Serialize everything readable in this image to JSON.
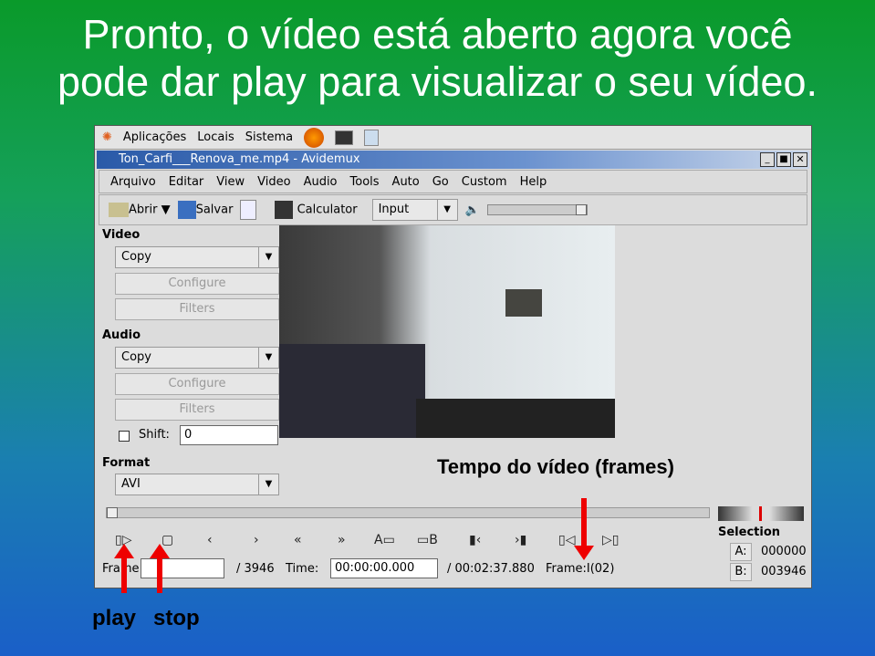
{
  "heading": {
    "line1": "Pronto, o vídeo está aberto agora você",
    "line2": "pode dar play para visualizar o seu vídeo."
  },
  "panel": {
    "items": [
      "Aplicações",
      "Locais",
      "Sistema"
    ]
  },
  "window": {
    "title": "Ton_Carfi___Renova_me.mp4 - Avidemux"
  },
  "menu": [
    "Arquivo",
    "Editar",
    "View",
    "Video",
    "Audio",
    "Tools",
    "Auto",
    "Go",
    "Custom",
    "Help"
  ],
  "toolbar": {
    "open": "Abrir",
    "save": "Salvar",
    "calculator": "Calculator",
    "input": "Input"
  },
  "side": {
    "video_label": "Video",
    "video_codec": "Copy",
    "configure": "Configure",
    "filters": "Filters",
    "audio_label": "Audio",
    "audio_codec": "Copy",
    "shift_label": "Shift:",
    "shift_value": "0",
    "format_label": "Format",
    "format_value": "AVI"
  },
  "bottom": {
    "frame_label": "Frame:",
    "frame_value": "",
    "total_frames": "/ 3946",
    "time_label": "Time:",
    "time_value": "00:00:00.000",
    "total_time": "/ 00:02:37.880",
    "frame_type": "Frame:I(02)",
    "selection": "Selection",
    "a_label": "A:",
    "a_value": "000000",
    "b_label": "B:",
    "b_value": "003946"
  },
  "annotations": {
    "timeline": "Tempo do vídeo (frames)",
    "play": "play",
    "stop": "stop"
  }
}
